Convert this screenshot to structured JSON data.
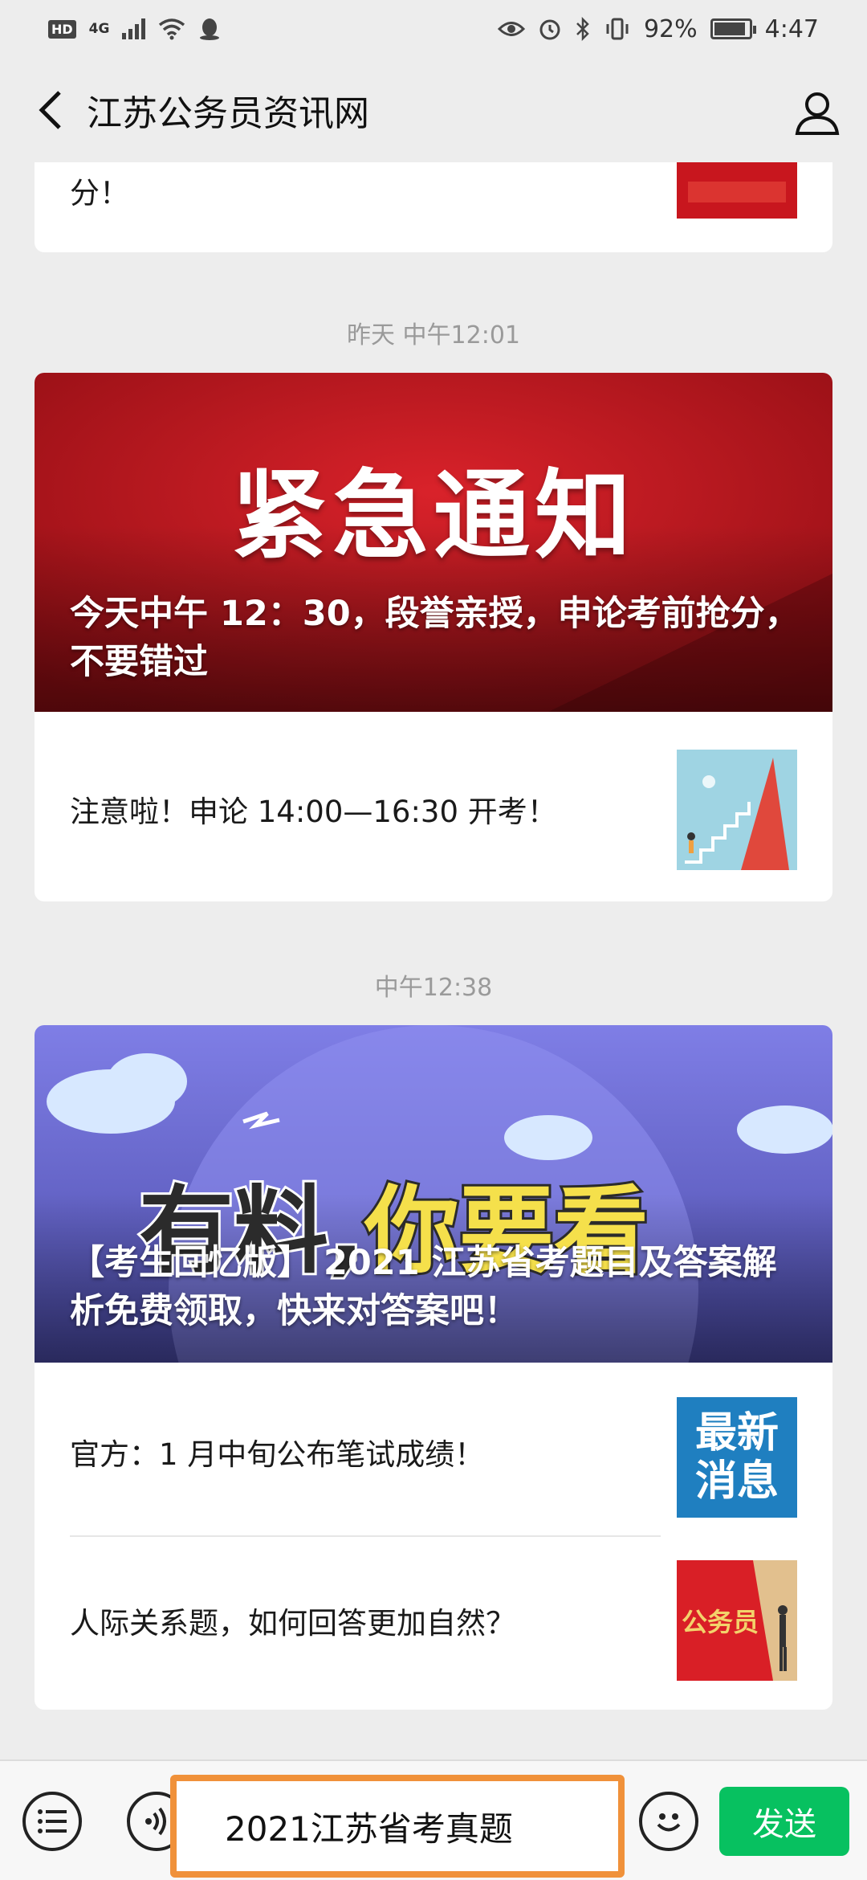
{
  "status_bar": {
    "left_badge": "HD",
    "signal": "4G",
    "battery": "92%",
    "battery_level": 0.92,
    "time": "4:47"
  },
  "nav": {
    "title": "江苏公务员资讯网"
  },
  "feed": {
    "prev_card_text": "分！",
    "time1": "昨天 中午12:01",
    "banner1": {
      "headline": "紧急通知",
      "caption": "今天中午 12：30，段誉亲授，申论考前抢分，不要错过"
    },
    "item1": "注意啦！申论 14:00—16:30 开考！",
    "time2": "中午12:38",
    "banner2": {
      "art_text_1": "有料,",
      "art_text_2": "你要看",
      "caption": "【考生回忆版】 2021 江苏省考题目及答案解析免费领取，快来对答案吧！"
    },
    "item2": "官方：1 月中旬公布笔试成绩！",
    "item2_thumb": "最新消息",
    "item3": "人际关系题，如何回答更加自然？",
    "item3_thumb": "公务员"
  },
  "input_bar": {
    "value": "2021江苏省考真题",
    "send_label": "发送"
  }
}
